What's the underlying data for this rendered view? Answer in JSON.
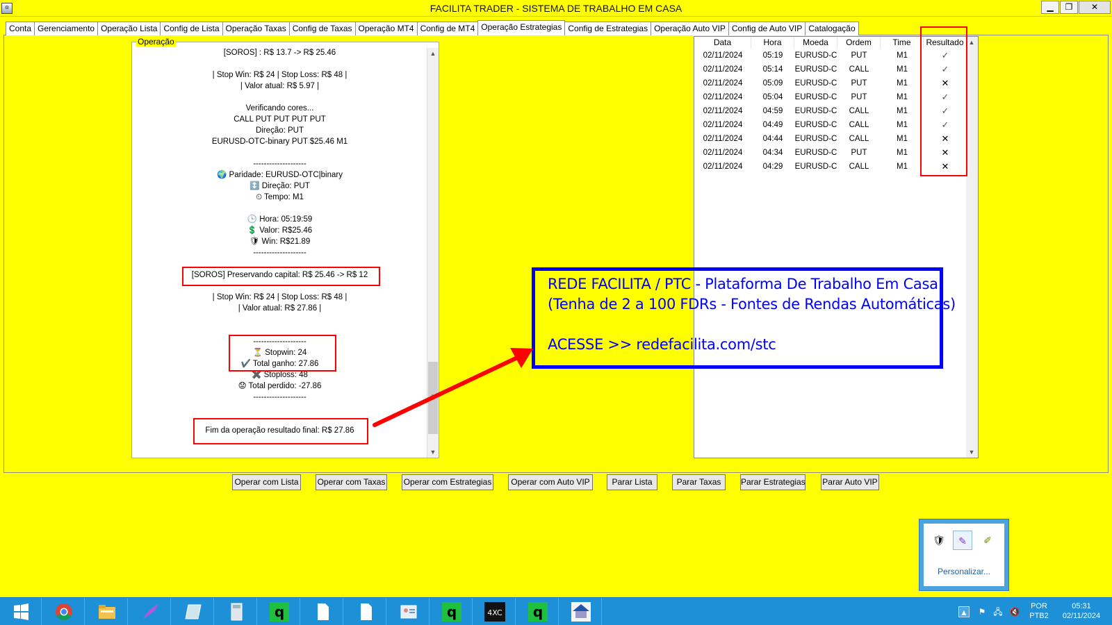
{
  "window": {
    "title": "FACILITA TRADER - SISTEMA DE TRABALHO EM CASA",
    "icon": "app-icon",
    "min_label": "▁",
    "max_label": "❐",
    "close_label": "✕"
  },
  "tabs": [
    {
      "label": "Conta"
    },
    {
      "label": "Gerenciamento"
    },
    {
      "label": "Operação Lista"
    },
    {
      "label": "Config de Lista"
    },
    {
      "label": "Operação Taxas"
    },
    {
      "label": "Config de Taxas"
    },
    {
      "label": "Operação MT4"
    },
    {
      "label": "Config de MT4"
    },
    {
      "label": "Operação Estrategias",
      "active": true
    },
    {
      "label": "Config de Estrategias"
    },
    {
      "label": "Operação Auto VIP"
    },
    {
      "label": "Config de Auto VIP"
    },
    {
      "label": "Catalogação"
    }
  ],
  "operacao": {
    "legend": "Operação",
    "lines": [
      "[SOROS] : R$ 13.7 -> R$ 25.46",
      "",
      "| Stop Win: R$ 24 | Stop Loss: R$ 48 |",
      "| Valor atual: R$ 5.97 |",
      "",
      "Verificando cores...",
      "CALL PUT PUT PUT PUT",
      "Direção: PUT",
      "EURUSD-OTC-binary PUT $25.46 M1",
      "",
      "--------------------",
      "🌍 Paridade: EURUSD-OTC|binary",
      "↕️ Direção: PUT",
      "⏲ Tempo: M1",
      "",
      "🕒 Hora: 05:19:59",
      "💲 Valor: R$25.46",
      "🛡 Win: R$21.89",
      "--------------------",
      "",
      "[SOROS] Preservando capital: R$ 25.46 -> R$ 12",
      "",
      "| Stop Win: R$ 24 | Stop Loss: R$ 48 |",
      "| Valor atual: R$ 27.86 |",
      "",
      "",
      "--------------------",
      "⏳ Stopwin: 24",
      "✔️ Total ganho: 27.86",
      "✖️ Stoploss: 48",
      "😟 Total perdido: -27.86",
      "--------------------",
      "",
      "",
      "Fim da operação resultado final: R$ 27.86"
    ]
  },
  "results": {
    "columns": [
      "Data",
      "Hora",
      "Moeda",
      "Ordem",
      "Time",
      "Resultado"
    ],
    "rows": [
      {
        "data": "02/11/2024",
        "hora": "05:19",
        "moeda": "EURUSD-C",
        "ordem": "PUT",
        "time": "M1",
        "resultado": "✓"
      },
      {
        "data": "02/11/2024",
        "hora": "05:14",
        "moeda": "EURUSD-C",
        "ordem": "CALL",
        "time": "M1",
        "resultado": "✓"
      },
      {
        "data": "02/11/2024",
        "hora": "05:09",
        "moeda": "EURUSD-C",
        "ordem": "PUT",
        "time": "M1",
        "resultado": "✕"
      },
      {
        "data": "02/11/2024",
        "hora": "05:04",
        "moeda": "EURUSD-C",
        "ordem": "PUT",
        "time": "M1",
        "resultado": "✓"
      },
      {
        "data": "02/11/2024",
        "hora": "04:59",
        "moeda": "EURUSD-C",
        "ordem": "CALL",
        "time": "M1",
        "resultado": "✓"
      },
      {
        "data": "02/11/2024",
        "hora": "04:49",
        "moeda": "EURUSD-C",
        "ordem": "CALL",
        "time": "M1",
        "resultado": "✓"
      },
      {
        "data": "02/11/2024",
        "hora": "04:44",
        "moeda": "EURUSD-C",
        "ordem": "CALL",
        "time": "M1",
        "resultado": "✕"
      },
      {
        "data": "02/11/2024",
        "hora": "04:34",
        "moeda": "EURUSD-C",
        "ordem": "PUT",
        "time": "M1",
        "resultado": "✕"
      },
      {
        "data": "02/11/2024",
        "hora": "04:29",
        "moeda": "EURUSD-C",
        "ordem": "CALL",
        "time": "M1",
        "resultado": "✕"
      }
    ]
  },
  "promo": {
    "line1": "REDE FACILITA / PTC - Plataforma De Trabalho Em Casa",
    "line2": "(Tenha de 2 a 100 FDRs - Fontes de Rendas Automáticas)",
    "line3": "ACESSE >>  redefacilita.com/stc"
  },
  "buttons": [
    {
      "label": "Operar com Lista"
    },
    {
      "label": "Operar com Taxas"
    },
    {
      "label": "Operar com Estrategias"
    },
    {
      "label": "Operar com Auto VIP"
    },
    {
      "label": "Parar Lista"
    },
    {
      "label": "Parar Taxas"
    },
    {
      "label": "Parar Estrategias"
    },
    {
      "label": "Parar Auto VIP"
    }
  ],
  "tray_popup": {
    "customize_label": "Personalizar..."
  },
  "taskbar": {
    "items": [
      "start-icon",
      "chrome-icon",
      "file-explorer-icon",
      "feather-icon",
      "notepad-icon",
      "calculator-icon",
      "app-q-icon",
      "document-icon",
      "document-icon",
      "contacts-icon",
      "app-q-icon",
      "4xc-icon",
      "app-q-icon",
      "facilita-icon"
    ],
    "language_top": "POR",
    "language_bottom": "PTB2",
    "clock_time": "05:31",
    "clock_date": "02/11/2024",
    "label_4xc": "4XC"
  },
  "colors": {
    "background": "#ffff00",
    "highlight_red": "#ff0000",
    "promo_blue": "#0000ff",
    "taskbar": "#1e90d8"
  }
}
